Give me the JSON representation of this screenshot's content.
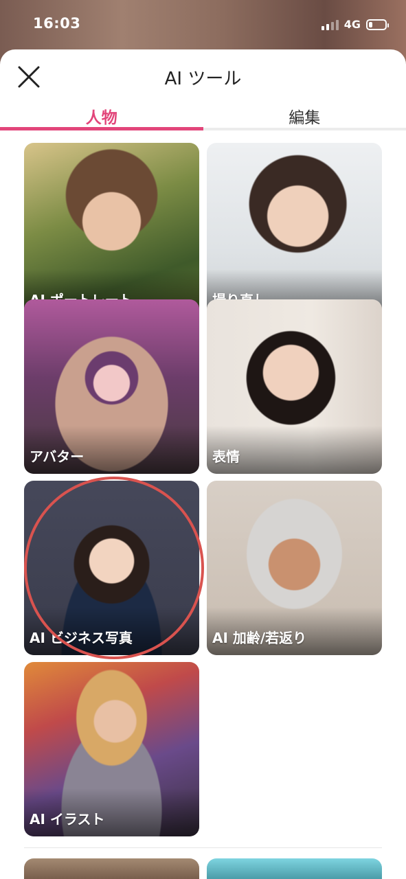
{
  "status_bar": {
    "time": "16:03",
    "network": "4G",
    "signal_bars": 4,
    "signal_active": 2,
    "battery_level": 0.22
  },
  "sheet": {
    "title": "AI ツール",
    "close_icon": "close-icon"
  },
  "tabs": [
    {
      "label": "人物",
      "active": true
    },
    {
      "label": "編集",
      "active": false
    }
  ],
  "colors": {
    "accent": "#e2457a",
    "highlight": "#d9534f"
  },
  "tools": [
    {
      "label": "AI ポートレート"
    },
    {
      "label": "撮り直し"
    },
    {
      "label": "アバター"
    },
    {
      "label": "表情"
    },
    {
      "label": "AI ビジネス写真"
    },
    {
      "label": "AI 加齢/若返り"
    },
    {
      "label": "AI イラスト"
    }
  ]
}
